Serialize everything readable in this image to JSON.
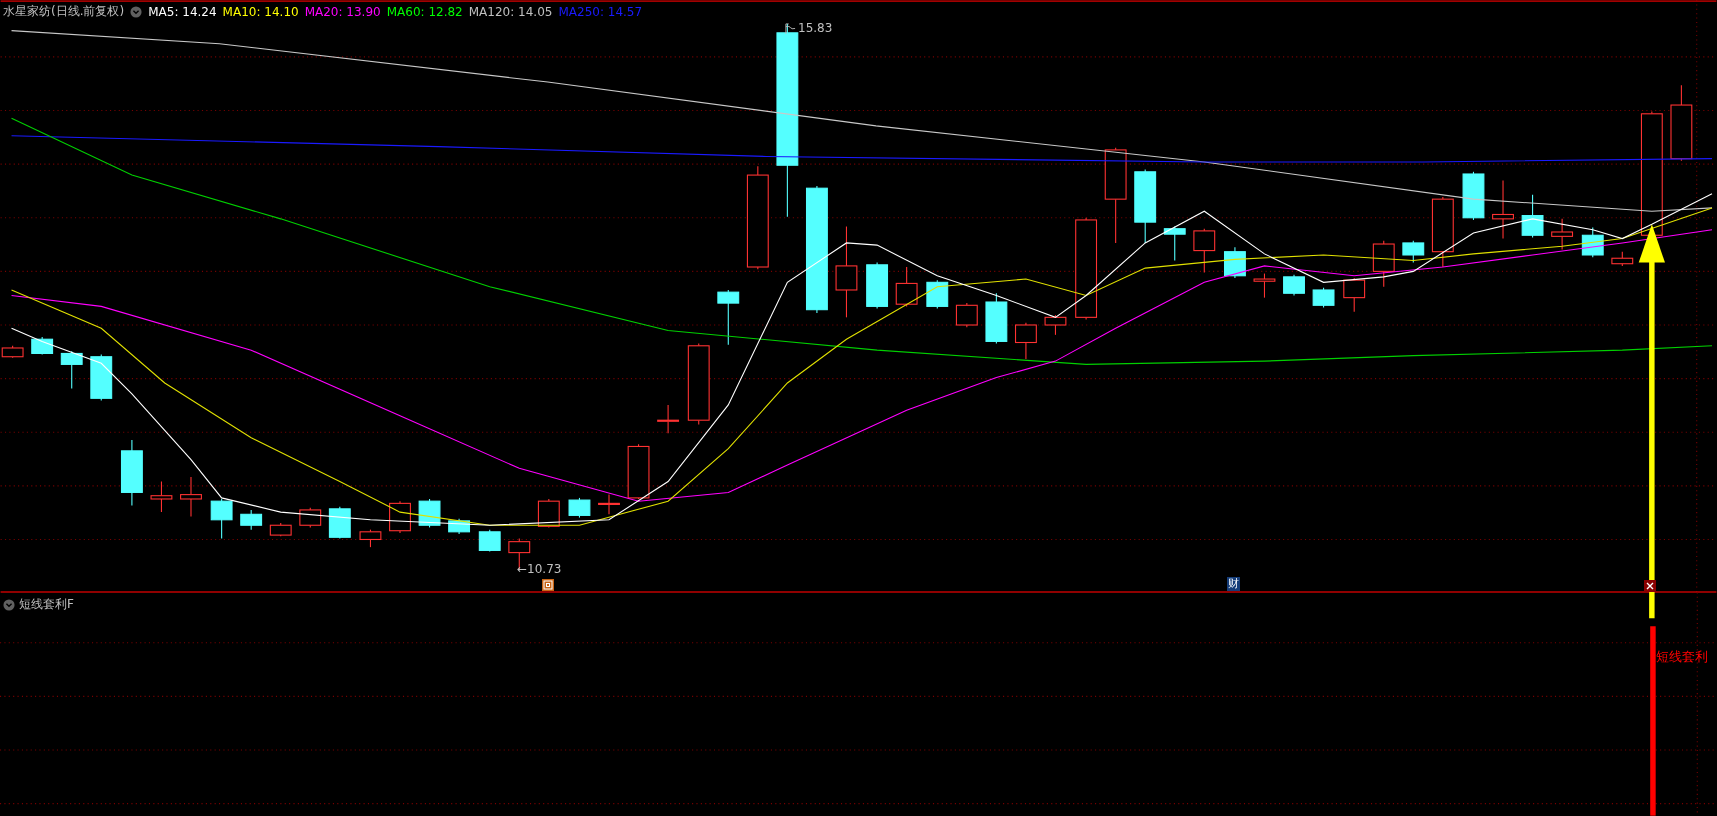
{
  "header": {
    "title": "水星家纺(日线.前复权)",
    "indicators": [
      {
        "label": "MA5: 14.24",
        "color": "#ffffff"
      },
      {
        "label": "MA10: 14.10",
        "color": "#ffff00"
      },
      {
        "label": "MA20: 13.90",
        "color": "#ff00ff"
      },
      {
        "label": "MA60: 12.82",
        "color": "#00ff00"
      },
      {
        "label": "MA120: 14.05",
        "color": "#c0c0c0"
      },
      {
        "label": "MA250: 14.57",
        "color": "#1a1aff"
      }
    ]
  },
  "price_labels": {
    "high": "15.83",
    "low": "←10.73"
  },
  "event_badge": "财",
  "indicator_panel": {
    "title": "短线套利F",
    "signal_label": "短线套利"
  }
}
